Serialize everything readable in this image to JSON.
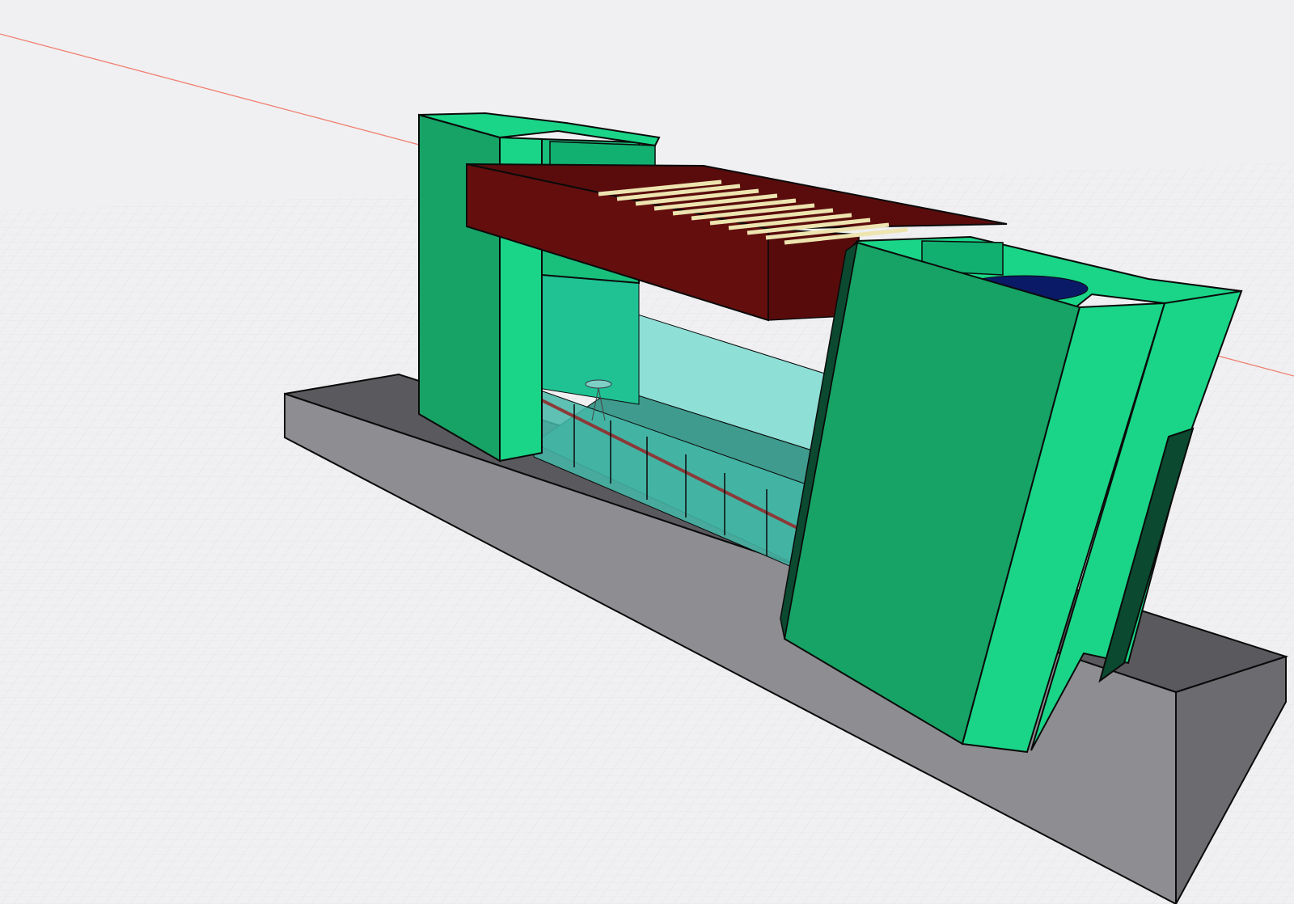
{
  "viewport": {
    "kind": "3d-model-viewport",
    "grid_visible": true,
    "axis_visible": true
  },
  "colors": {
    "background": "#f0f0f2",
    "grid_line": "#d8d8dc",
    "axis_red": "#f08070",
    "base_top": "#5a5a5e",
    "base_front": "#909094",
    "base_side": "#6c6c70",
    "tower_dark": "#16a365",
    "tower_light": "#1ad587",
    "tower_shadow": "#0b4a30",
    "beam_front": "#640e0e",
    "beam_top": "#5a0c0c",
    "slats": "#ede4b0",
    "glass": "#5fd6c3",
    "glass_deep": "#3aa899",
    "roof_disc": "#0a1a66",
    "outline": "#0a0a0a"
  },
  "model": {
    "parts": [
      "base-slab",
      "left-tower",
      "right-tower",
      "roof-beam",
      "glass-curtain-wall",
      "louver-slats"
    ]
  }
}
